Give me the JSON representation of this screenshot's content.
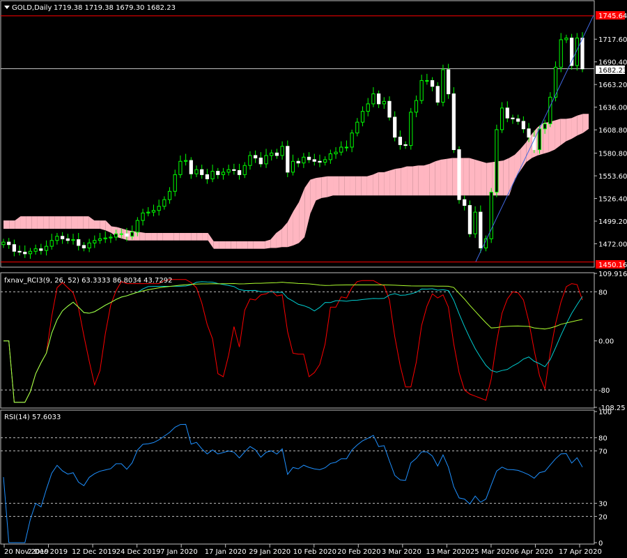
{
  "main": {
    "symbol_label": "GOLD,Daily",
    "ohlc_label": "1719.38 1719.38 1679.30 1682.23",
    "ylim": [
      1444.8,
      1763
    ],
    "y_ticks": [
      "1717.60",
      "1690.40",
      "1663.20",
      "1636.00",
      "1608.80",
      "1580.80",
      "1553.60",
      "1526.40",
      "1499.20",
      "1472.00"
    ],
    "price_tags": {
      "high": {
        "label": "1745.64",
        "color": "#FF0000"
      },
      "current": {
        "label": "1682.23",
        "color": "#FFFFFF"
      },
      "low": {
        "label": "1450.16",
        "color": "#FF0000"
      }
    },
    "colors": {
      "bull": "#00FF00",
      "bear": "#FFFFFF",
      "wick": "#00FF00",
      "cloud_bull": "#FFB6C1",
      "cloud_bear": "#AFEEEE",
      "trendline": "#4169E1"
    }
  },
  "rci": {
    "label": "fxnav_RCI3(9, 26, 52) 63.3333 86.8034 43.7292",
    "ylim": [
      -108.25,
      109.9167
    ],
    "y_ticks": [
      "109.9167",
      "80",
      "0.00",
      "-80",
      "-108.25"
    ],
    "levels": [
      80,
      -80
    ],
    "colors": {
      "fast": "#FF0000",
      "mid": "#00CED1",
      "slow": "#ADFF2F"
    }
  },
  "rsi": {
    "label": "RSI(14) 57.6033",
    "ylim": [
      0,
      100
    ],
    "y_ticks": [
      "100",
      "80",
      "70",
      "30",
      "20",
      "0"
    ],
    "levels": [
      80,
      70,
      30,
      20
    ],
    "color": "#1E90FF"
  },
  "x_labels": [
    "20 Nov 2019",
    "2 Dec 2019",
    "12 Dec 2019",
    "24 Dec 2019",
    "7 Jan 2020",
    "17 Jan 2020",
    "29 Jan 2020",
    "10 Feb 2020",
    "20 Feb 2020",
    "3 Mar 2020",
    "13 Mar 2020",
    "25 Mar 2020",
    "6 Apr 2020",
    "17 Apr 2020"
  ],
  "chart_data": {
    "type": "candlestick",
    "bars": 105,
    "close": [
      1474,
      1471,
      1463,
      1462,
      1460,
      1463,
      1466,
      1464,
      1469,
      1476,
      1481,
      1478,
      1476,
      1477,
      1470,
      1467,
      1473,
      1476,
      1478,
      1479,
      1480,
      1484,
      1484,
      1481,
      1486,
      1500,
      1509,
      1510,
      1512,
      1517,
      1525,
      1535,
      1555,
      1571,
      1572,
      1556,
      1561,
      1555,
      1550,
      1559,
      1555,
      1558,
      1561,
      1560,
      1555,
      1566,
      1578,
      1575,
      1568,
      1578,
      1581,
      1578,
      1589,
      1558,
      1571,
      1569,
      1576,
      1573,
      1571,
      1570,
      1573,
      1580,
      1582,
      1588,
      1588,
      1605,
      1618,
      1631,
      1640,
      1652,
      1640,
      1643,
      1624,
      1600,
      1591,
      1590,
      1630,
      1644,
      1668,
      1668,
      1661,
      1642,
      1681,
      1652,
      1585,
      1525,
      1518,
      1484,
      1510,
      1467,
      1478,
      1534,
      1609,
      1635,
      1623,
      1622,
      1619,
      1610,
      1600,
      1585,
      1610,
      1616,
      1648,
      1684,
      1717,
      1719,
      1686,
      1719,
      1682
    ],
    "ichimoku": {
      "span_a": [
        1500,
        1500,
        1500,
        1505,
        1505,
        1505,
        1505,
        1505,
        1505,
        1505,
        1505,
        1505,
        1505,
        1505,
        1505,
        1505,
        1500,
        1500,
        1500,
        1493,
        1492,
        1490,
        1488,
        1487,
        1486,
        1485,
        1485,
        1485,
        1485,
        1485,
        1485,
        1485,
        1485,
        1485,
        1485,
        1485,
        1485,
        1475,
        1475,
        1475,
        1475,
        1475,
        1475,
        1475,
        1475,
        1475,
        1475,
        1477,
        1485,
        1490,
        1498,
        1511,
        1522,
        1539,
        1549,
        1551,
        1552,
        1553,
        1553,
        1553,
        1553,
        1553,
        1553,
        1553,
        1553,
        1555,
        1558,
        1558,
        1560,
        1562,
        1563,
        1565,
        1565,
        1566,
        1566,
        1568,
        1571,
        1573,
        1574,
        1575,
        1575,
        1575,
        1575,
        1573,
        1571,
        1569,
        1570,
        1571,
        1572,
        1575,
        1579,
        1586,
        1594,
        1604,
        1612,
        1617,
        1618,
        1620,
        1622,
        1622,
        1623,
        1626,
        1628,
        1628
      ],
      "span_b": [
        1490,
        1490,
        1490,
        1490,
        1490,
        1490,
        1490,
        1490,
        1490,
        1490,
        1490,
        1490,
        1490,
        1490,
        1490,
        1490,
        1490,
        1490,
        1488,
        1485,
        1480,
        1478,
        1476,
        1476,
        1476,
        1476,
        1476,
        1476,
        1476,
        1476,
        1476,
        1476,
        1476,
        1476,
        1476,
        1476,
        1476,
        1466,
        1466,
        1466,
        1466,
        1466,
        1466,
        1466,
        1466,
        1466,
        1466,
        1467,
        1467,
        1468,
        1468,
        1470,
        1473,
        1480,
        1508,
        1524,
        1527,
        1528,
        1530,
        1530,
        1530,
        1530,
        1530,
        1530,
        1530,
        1530,
        1530,
        1530,
        1530,
        1530,
        1530,
        1530,
        1530,
        1530,
        1530,
        1530,
        1530,
        1530,
        1530,
        1530,
        1530,
        1530,
        1530,
        1530,
        1530,
        1530,
        1530,
        1530,
        1530,
        1530,
        1550,
        1560,
        1570,
        1575,
        1578,
        1580,
        1582,
        1585,
        1590,
        1595,
        1598,
        1602,
        1605,
        1610
      ]
    },
    "high_tag": 1745.64,
    "current_tag": 1682.23,
    "low_tag": 1450.16,
    "rci_last": {
      "fast": 63.3333,
      "mid": 86.8034,
      "slow": 43.7292
    },
    "rsi_last": 57.6033
  }
}
